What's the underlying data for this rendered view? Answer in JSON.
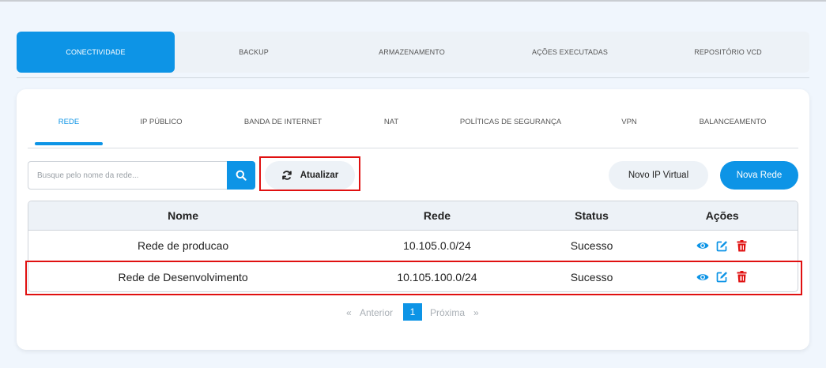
{
  "top_tabs": [
    "CONECTIVIDADE",
    "BACKUP",
    "ARMAZENAMENTO",
    "AÇÕES EXECUTADAS",
    "REPOSITÓRIO VCD"
  ],
  "sub_tabs": [
    "REDE",
    "IP PÚBLICO",
    "BANDA DE INTERNET",
    "NAT",
    "POLÍTICAS DE SEGURANÇA",
    "VPN",
    "BALANCEAMENTO"
  ],
  "toolbar": {
    "search_placeholder": "Busque pelo nome da rede...",
    "search_value": "",
    "refresh_label": "Atualizar",
    "new_vip_label": "Novo IP Virtual",
    "new_network_label": "Nova Rede"
  },
  "table": {
    "headers": [
      "Nome",
      "Rede",
      "Status",
      "Ações"
    ],
    "rows": [
      {
        "name": "Rede de producao",
        "network": "10.105.0.0/24",
        "status": "Sucesso"
      },
      {
        "name": "Rede de Desenvolvimento",
        "network": "10.105.100.0/24",
        "status": "Sucesso"
      }
    ]
  },
  "pagination": {
    "prev_symbol": "«",
    "prev_label": "Anterior",
    "current_page": "1",
    "next_label": "Próxima",
    "next_symbol": "»"
  },
  "colors": {
    "accent": "#0d94e6",
    "danger": "#e01010",
    "highlight": "#e01010"
  }
}
